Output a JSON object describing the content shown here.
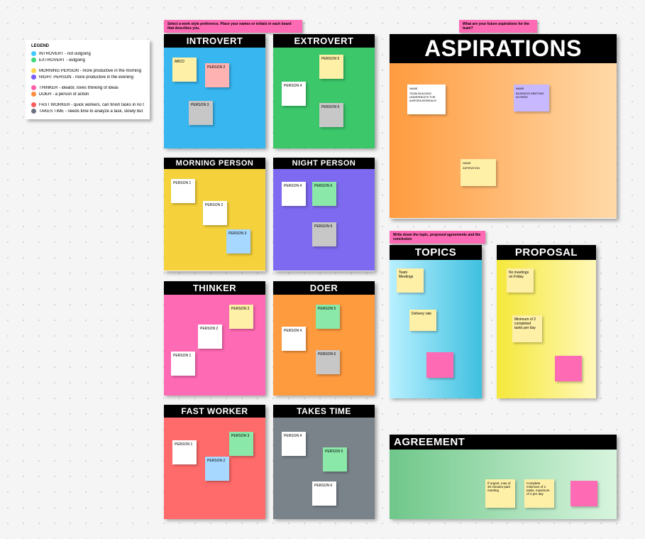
{
  "legend": {
    "title": "LEGEND",
    "rows": [
      {
        "color": "#3fc7ff",
        "text": "INTROVERT - not outgoing"
      },
      {
        "color": "#3fd97a",
        "text": "EXTROVERT - outgoing"
      },
      {
        "color": "#ffd54a",
        "text": "MORNING PERSON - more productive in the morning"
      },
      {
        "color": "#7a5cff",
        "text": "NIGHT PERSON - more productive in the evening"
      },
      {
        "color": "#ff5fa8",
        "text": "THINKER - ideator, loves thinking of ideas"
      },
      {
        "color": "#ff8c3f",
        "text": "DOER - a person of action"
      },
      {
        "color": "#ff5c5c",
        "text": "FAST WORKER - quick workers, can finish tasks in no time"
      },
      {
        "color": "#6b7280",
        "text": "TAKES TIME - needs time to analyze a task, slowly but surely"
      }
    ]
  },
  "labels": {
    "workstyle": "Select a work style preference. Place your names or initials in each board that describes you.",
    "aspirations": "What are your future aspirations for the team?",
    "agreements": "Write down the topic, proposed agreements and the conclusion"
  },
  "boards": {
    "introvert": {
      "title": "INTROVERT",
      "notes": {
        "a": "ABCD",
        "b": "PERSON 2",
        "c": "PERSON 3"
      }
    },
    "extrovert": {
      "title": "EXTROVERT",
      "notes": {
        "a": "PERSON 5",
        "b": "PERSON 4",
        "c": "PERSON 6"
      }
    },
    "morning": {
      "title": "MORNING PERSON",
      "notes": {
        "a": "PERSON 1",
        "b": "PERSON 2",
        "c": "PERSON 3"
      }
    },
    "night": {
      "title": "NIGHT PERSON",
      "notes": {
        "a": "PERSON 4",
        "b": "PERSON 5",
        "c": "PERSON 6"
      }
    },
    "thinker": {
      "title": "THINKER",
      "notes": {
        "a": "PERSON 3",
        "b": "PERSON 2",
        "c": "PERSON 1"
      }
    },
    "doer": {
      "title": "DOER",
      "notes": {
        "a": "PERSON 5",
        "b": "PERSON 4",
        "c": "PERSON 6"
      }
    },
    "fast": {
      "title": "FAST WORKER",
      "notes": {
        "a": "PERSON 3",
        "b": "PERSON 1",
        "c": "PERSON 2"
      }
    },
    "takes": {
      "title": "TAKES TIME",
      "notes": {
        "a": "PERSON 4",
        "b": "PERSON 5",
        "c": "PERSON 6"
      }
    },
    "aspirations": {
      "title": "ASPIRATIONS",
      "notes": {
        "a_name": "NAME",
        "a_text": "TEAM BUILDING UNDERNEATH THE AURORA BOREALIS",
        "b_name": "NAME",
        "b_text": "BUSINESS MEETING IN PARIS",
        "c_name": "NAME",
        "c_text": "ASPIRATION"
      }
    },
    "topics": {
      "title": "TOPICS",
      "notes": {
        "a": "Team Meetings",
        "b": "Delivery rate"
      }
    },
    "proposal": {
      "title": "PROPOSAL",
      "notes": {
        "a": "No meetings on Friday",
        "b": "Minimum of 2 completed tasks per day"
      }
    },
    "agreement": {
      "title": "AGREEMENT",
      "notes": {
        "a": "If urgent, max of 30 minutes paid meeting",
        "b": "Complete minimum of 2 tasks, maximum of 4 per day"
      }
    }
  }
}
